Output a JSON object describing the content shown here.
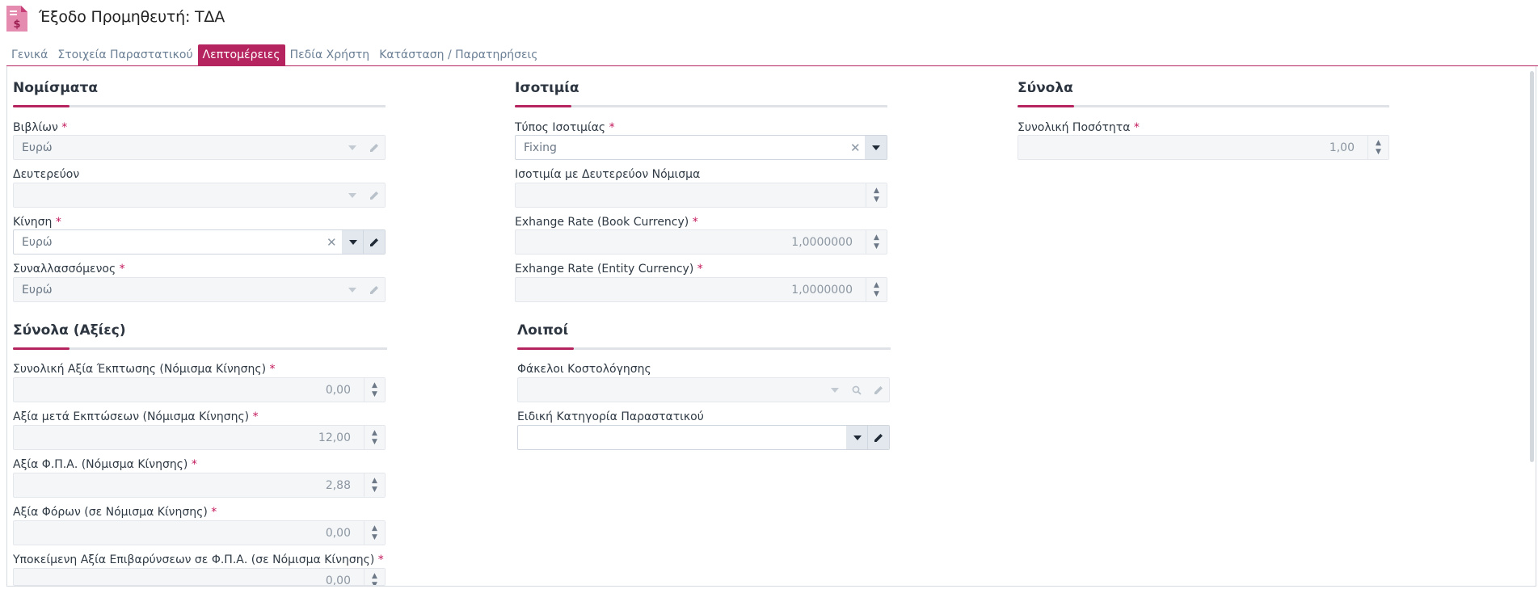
{
  "header": {
    "title": "Έξοδο Προμηθευτή: ΤΔΑ",
    "icon": "document-dollar-icon",
    "icon_color": "#c63f77"
  },
  "tabs": [
    {
      "label": "Γενικά",
      "active": false
    },
    {
      "label": "Στοιχεία Παραστατικού",
      "active": false
    },
    {
      "label": "Λεπτομέρειες",
      "active": true
    },
    {
      "label": "Πεδία Χρήστη",
      "active": false
    },
    {
      "label": "Κατάσταση / Παρατηρήσεις",
      "active": false
    }
  ],
  "accent_color": "#b5245e",
  "required_mark": "*",
  "currencies": {
    "title": "Νομίσματα",
    "books_label": "Βιβλίων",
    "books_value": "Ευρώ",
    "secondary_label": "Δευτερεύον",
    "secondary_value": "",
    "movement_label": "Κίνηση",
    "movement_value": "Ευρώ",
    "counterparty_label": "Συναλλασσόμενος",
    "counterparty_value": "Ευρώ"
  },
  "exchange": {
    "title": "Ισοτιμία",
    "type_label": "Τύπος Ισοτιμίας",
    "type_value": "Fixing",
    "secondary_rate_label": "Ισοτιμία με Δευτερεύον Νόμισμα",
    "secondary_rate_value": "",
    "book_rate_label": "Exhange Rate (Book Currency)",
    "book_rate_value": "1,0000000",
    "entity_rate_label": "Exhange Rate (Entity Currency)",
    "entity_rate_value": "1,0000000"
  },
  "totals": {
    "title": "Σύνολα",
    "qty_label": "Συνολική Ποσότητα",
    "qty_value": "1,00"
  },
  "value_totals": {
    "title": "Σύνολα (Αξίες)",
    "discount_label": "Συνολική Αξία Έκπτωσης (Νόμισμα Κίνησης)",
    "discount_value": "0,00",
    "after_discount_label": "Αξία μετά Εκπτώσεων (Νόμισμα Κίνησης)",
    "after_discount_value": "12,00",
    "vat_label": "Αξία Φ.Π.Α. (Νόμισμα Κίνησης)",
    "vat_value": "2,88",
    "taxes_label": "Αξία Φόρων (σε Νόμισμα Κίνησης)",
    "taxes_value": "0,00",
    "charges_label": "Υποκείμενη Αξία Επιβαρύνσεων σε Φ.Π.Α. (σε Νόμισμα Κίνησης)",
    "charges_value": "0,00"
  },
  "other": {
    "title": "Λοιποί",
    "costing_label": "Φάκελοι Κοστολόγησης",
    "costing_value": "",
    "special_category_label": "Ειδική Κατηγορία Παραστατικού",
    "special_category_value": ""
  }
}
